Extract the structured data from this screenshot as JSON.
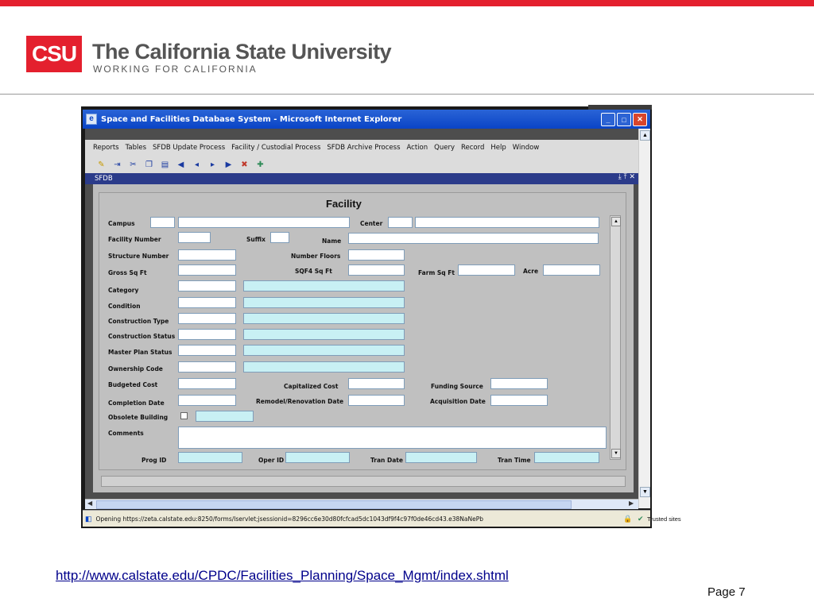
{
  "header": {
    "logo_text": "CSU",
    "title": "The California State University",
    "subtitle": "WORKING FOR CALIFORNIA"
  },
  "window": {
    "title": "Space and Facilities Database System - Microsoft Internet Explorer",
    "menu": [
      "Reports",
      "Tables",
      "SFDB Update Process",
      "Facility / Custodial Process",
      "SFDB Archive Process",
      "Action",
      "Query",
      "Record",
      "Help",
      "Window"
    ],
    "inner_window_title": "SFDB",
    "status_url": "Opening https://zeta.calstate.edu:8250/forms/lservlet;jsessionid=8296cc6e30d80fcfcad5dc1043df9f4c97f0de46cd43.e38NaNePb",
    "trusted": "Trusted sites"
  },
  "form": {
    "title": "Facility",
    "labels": {
      "campus": "Campus",
      "center": "Center",
      "facility_number": "Facility Number",
      "suffix": "Suffix",
      "name": "Name",
      "structure_number": "Structure Number",
      "number_floors": "Number Floors",
      "gross_sq_ft": "Gross Sq Ft",
      "sqf4_sq_ft": "SQF4 Sq Ft",
      "farm_sq_ft": "Farm Sq Ft",
      "acre": "Acre",
      "category": "Category",
      "condition": "Condition",
      "construction_type": "Construction Type",
      "construction_status": "Construction Status",
      "master_plan_status": "Master Plan Status",
      "ownership_code": "Ownership Code",
      "budgeted_cost": "Budgeted Cost",
      "capitalized_cost": "Capitalized Cost",
      "funding_source": "Funding Source",
      "completion_date": "Completion Date",
      "remodel_renovation_date": "Remodel/Renovation Date",
      "acquisition_date": "Acquisition Date",
      "obsolete_building": "Obsolete Building",
      "comments": "Comments",
      "prog_id": "Prog ID",
      "oper_id": "Oper ID",
      "tran_date": "Tran Date",
      "tran_time": "Tran Time"
    }
  },
  "footer": {
    "link": "http://www.calstate.edu/CPDC/Facilities_Planning/Space_Mgmt/index.shtml",
    "page": "Page 7"
  },
  "colors": {
    "brand_red": "#e4202e",
    "xp_blue": "#0a44c6",
    "field_cyan": "#c8f0f4"
  }
}
